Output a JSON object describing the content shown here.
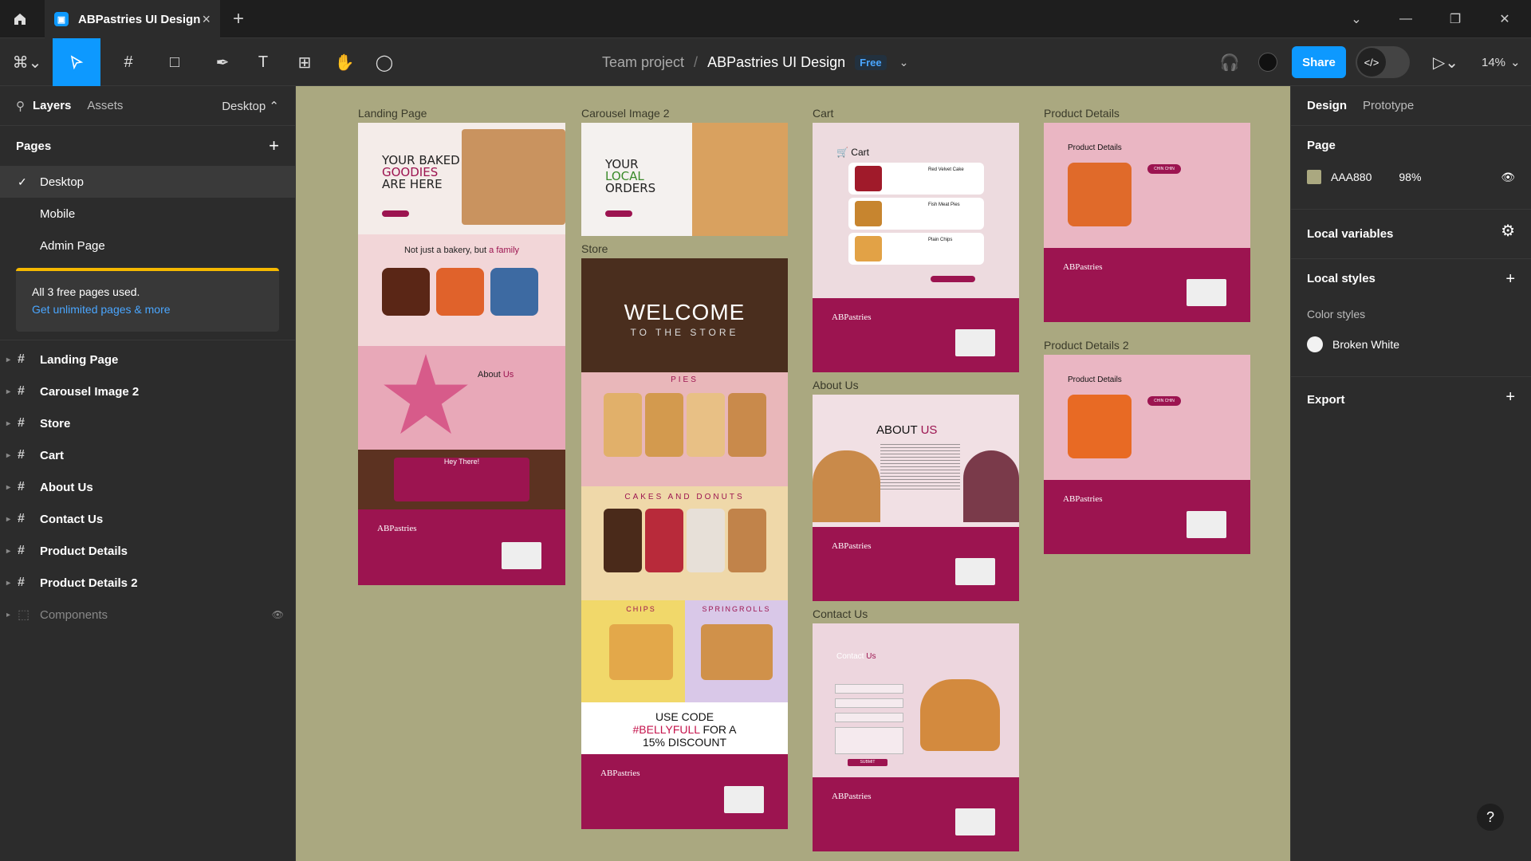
{
  "titlebar": {
    "tab_title": "ABPastries UI Design",
    "tab_close": "×",
    "new_tab": "+"
  },
  "toolbar": {
    "breadcrumb_team": "Team project",
    "breadcrumb_sep": "/",
    "file_name": "ABPastries UI Design",
    "plan_badge": "Free",
    "share_label": "Share",
    "dev_mode_label": "</>",
    "zoom_level": "14%"
  },
  "left_panel": {
    "tab_layers": "Layers",
    "tab_assets": "Assets",
    "device": "Desktop",
    "pages_title": "Pages",
    "pages": [
      {
        "label": "Desktop",
        "selected": true
      },
      {
        "label": "Mobile"
      },
      {
        "label": "Admin Page"
      }
    ],
    "notice_text": "All 3 free pages used.",
    "notice_link": "Get unlimited pages & more",
    "layers": [
      "Landing Page",
      "Carousel Image 2",
      "Store",
      "Cart",
      "About Us",
      "Contact Us",
      "Product Details",
      "Product Details 2"
    ],
    "components": "Components"
  },
  "canvas": {
    "bg_color": "#aaa880",
    "frames": {
      "landing": "Landing Page",
      "carousel": "Carousel Image 2",
      "store": "Store",
      "cart": "Cart",
      "about": "About Us",
      "contact": "Contact Us",
      "product": "Product Details",
      "product2": "Product Details 2"
    },
    "landing": {
      "hero": "YOUR BAKED",
      "hero2": "GOODIES",
      "hero3": "ARE HERE",
      "tagline": "Not just a bakery, but",
      "tagline_accent": "a family",
      "about": "About",
      "about_accent": "Us",
      "hey": "Hey There!",
      "brand": "ABPastries"
    },
    "carousel": {
      "l1": "YOUR",
      "l2": "LOCAL",
      "l3": "ORDERS"
    },
    "store": {
      "welcome": "WELCOME",
      "to_store": "TO THE STORE",
      "pies": "PIES",
      "cakes": "CAKES AND DONUTS",
      "chips": "CHIPS",
      "springrolls": "SPRINGROLLS",
      "promo1": "USE CODE",
      "promo2": "#BELLYFULL",
      "promo3": "FOR A",
      "promo4": "15% DISCOUNT",
      "brand": "ABPastries"
    },
    "cart": {
      "title": "Cart",
      "items": [
        "Red Velvet Cake",
        "Fish Meat Pies",
        "Plain Chips"
      ],
      "brand": "ABPastries"
    },
    "about": {
      "title": "ABOUT",
      "title_accent": "US",
      "brand": "ABPastries"
    },
    "contact": {
      "title": "Contact",
      "title_accent": "Us",
      "submit": "SUBMIT",
      "brand": "ABPastries"
    },
    "product": {
      "title": "Product Details",
      "tag": "CHIN CHIN",
      "brand": "ABPastries"
    },
    "product2": {
      "title": "Product Details",
      "tag": "CHIN CHIN",
      "brand": "ABPastries"
    }
  },
  "right_panel": {
    "tab_design": "Design",
    "tab_prototype": "Prototype",
    "page_title": "Page",
    "page_color": "AAA880",
    "page_opacity": "98%",
    "local_variables": "Local variables",
    "local_styles": "Local styles",
    "color_styles": "Color styles",
    "style_name": "Broken White",
    "export": "Export"
  },
  "help": "?"
}
